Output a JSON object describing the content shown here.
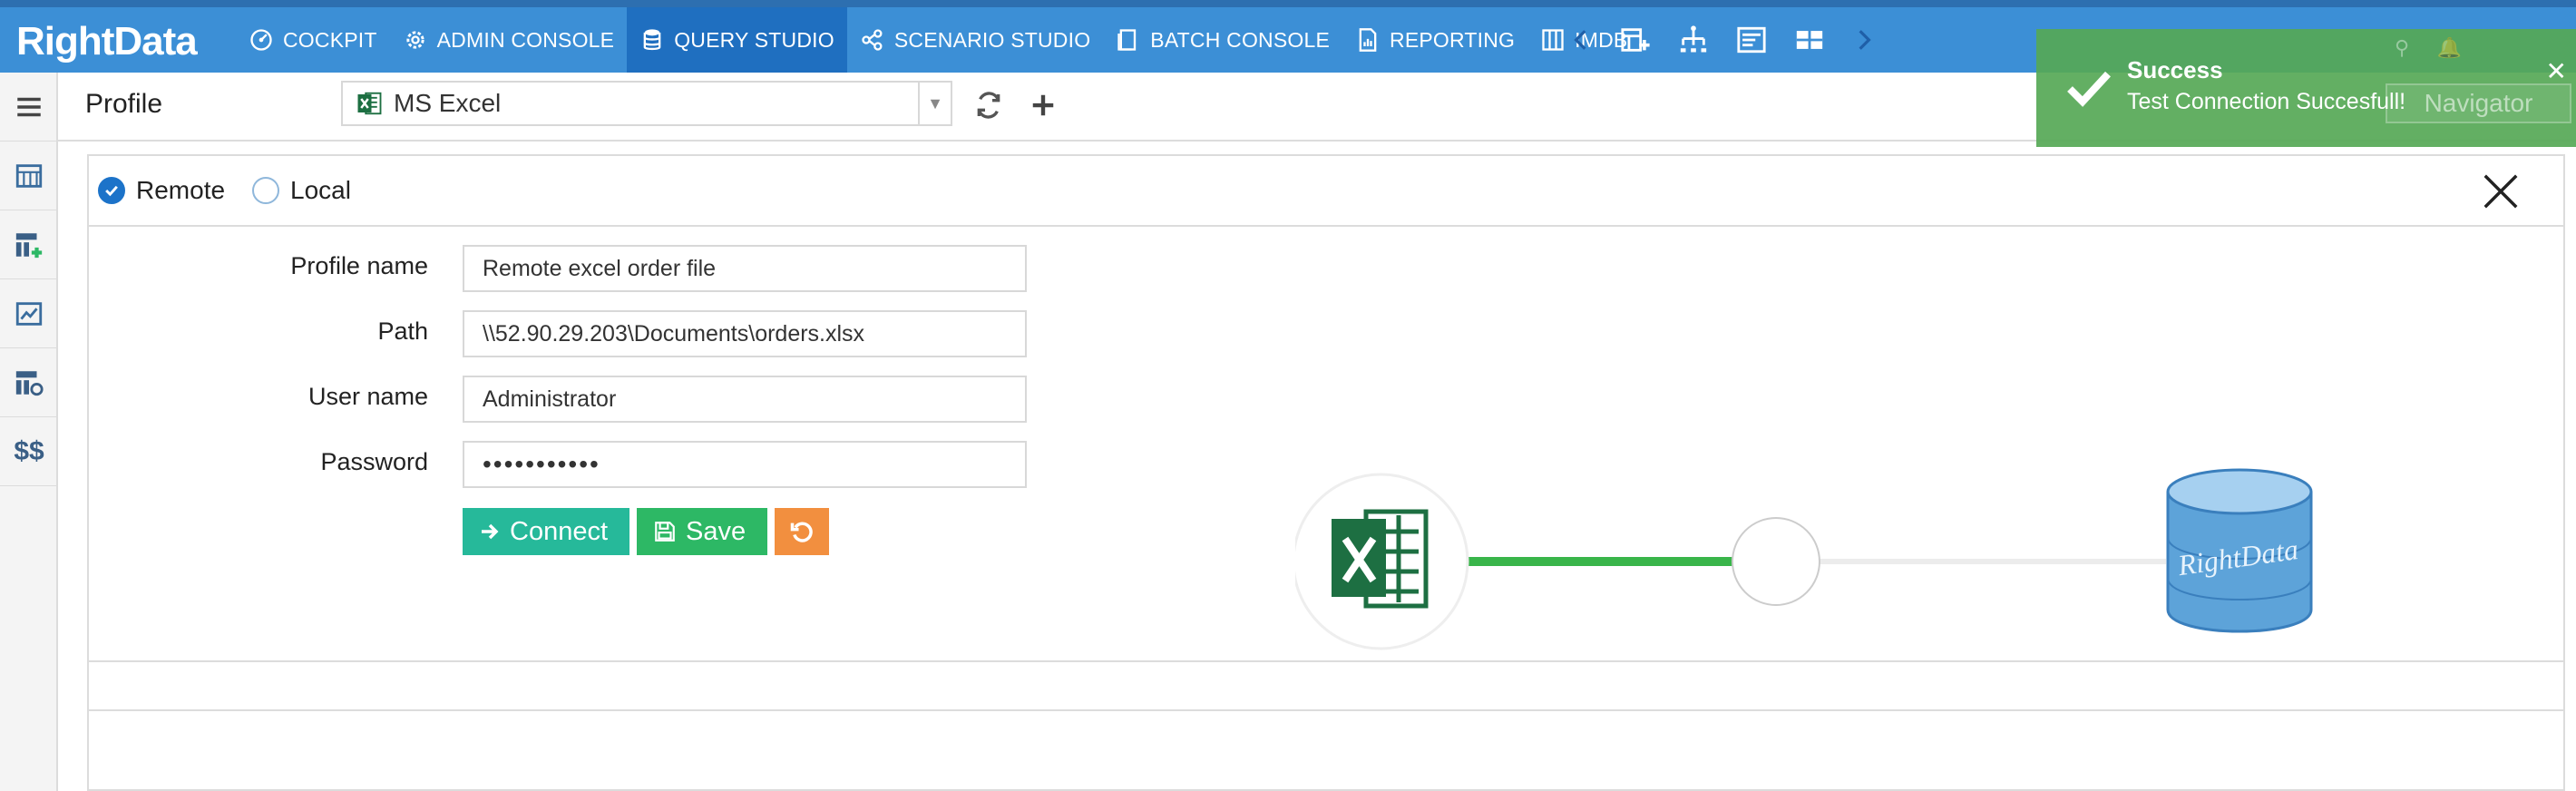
{
  "app": {
    "logo": "RightData",
    "brand_color": "#3c8fd6",
    "active_color": "#1f6fc0"
  },
  "nav": {
    "items": [
      {
        "label": "COCKPIT",
        "icon": "cockpit-icon"
      },
      {
        "label": "ADMIN CONSOLE",
        "icon": "gear-icon"
      },
      {
        "label": "QUERY STUDIO",
        "icon": "database-icon",
        "active": true
      },
      {
        "label": "SCENARIO STUDIO",
        "icon": "scenario-icon"
      },
      {
        "label": "BATCH CONSOLE",
        "icon": "batch-icon"
      },
      {
        "label": "REPORTING",
        "icon": "report-icon"
      },
      {
        "label": "IMDB",
        "icon": "imdb-icon"
      }
    ]
  },
  "header": {
    "title": "Profile",
    "profile_select": "MS Excel"
  },
  "toast": {
    "title": "Success",
    "message": "Test Connection Succesfull!",
    "background_hint": "Navigator",
    "color": "#56a856"
  },
  "panel": {
    "radio_remote": "Remote",
    "radio_local": "Local",
    "selected": "Remote"
  },
  "form": {
    "profile_name_label": "Profile name",
    "profile_name_value": "Remote excel order file",
    "path_label": "Path",
    "path_value": "\\\\52.90.29.203\\Documents\\orders.xlsx",
    "user_label": "User name",
    "user_value": "Administrator",
    "password_label": "Password",
    "password_value": "•••••••••••",
    "connect_label": "Connect",
    "save_label": "Save"
  },
  "diagram": {
    "target_label": "RightData",
    "connected": true
  },
  "rail": {
    "dollar_label": "$$"
  }
}
